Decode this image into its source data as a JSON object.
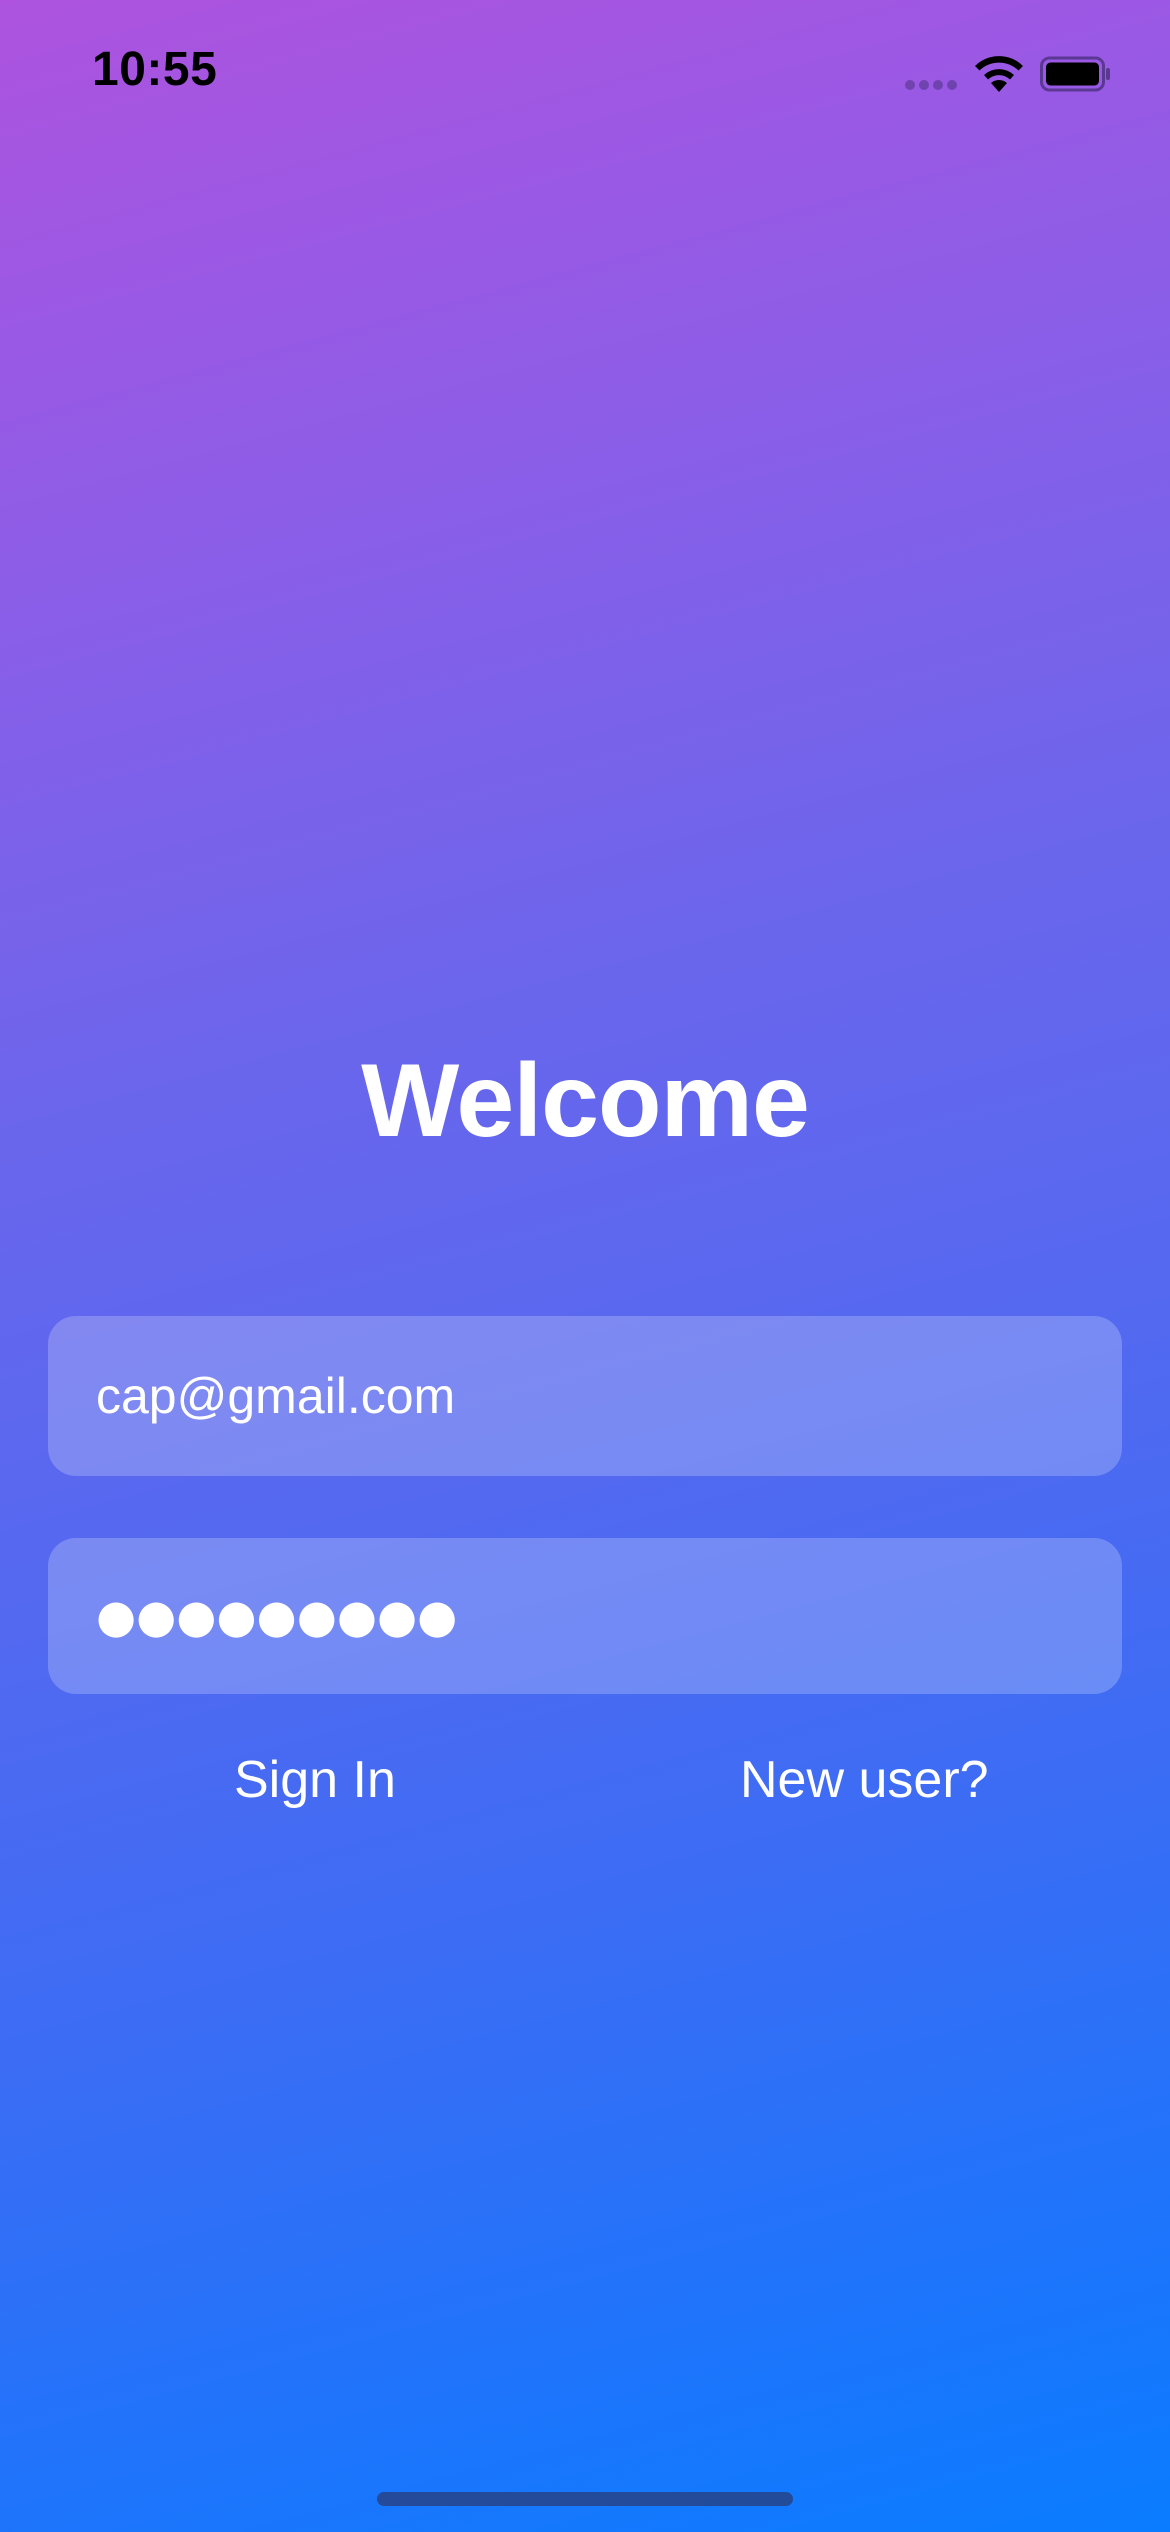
{
  "status_bar": {
    "time": "10:55",
    "icons": [
      "cellular-signal-icon",
      "wifi-icon",
      "battery-icon"
    ]
  },
  "login": {
    "title": "Welcome",
    "email_value": "cap@gmail.com",
    "password_masked": "●●●●●●●●●",
    "sign_in_label": "Sign In",
    "new_user_label": "New user?"
  },
  "colors": {
    "gradient_top": "#ad53df",
    "gradient_bottom": "#0a7cff",
    "text": "#ffffff"
  }
}
